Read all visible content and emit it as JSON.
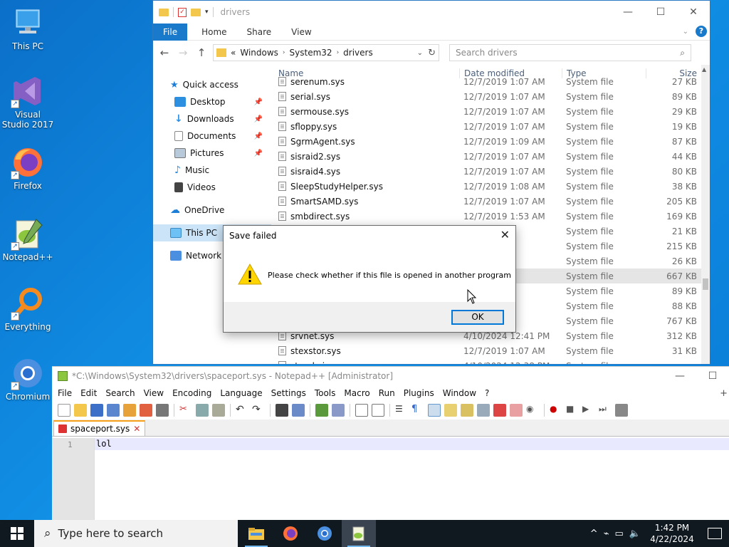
{
  "desktop": {
    "icons": [
      {
        "label": "This PC"
      },
      {
        "label": "Visual Studio 2017"
      },
      {
        "label": "Firefox"
      },
      {
        "label": "Notepad++"
      },
      {
        "label": "Everything"
      },
      {
        "label": "Chromium"
      }
    ]
  },
  "explorer": {
    "title": "drivers",
    "ribbon_tabs": [
      "File",
      "Home",
      "Share",
      "View"
    ],
    "address": {
      "parts": [
        "Windows",
        "System32",
        "drivers"
      ],
      "prefix": "«"
    },
    "search_placeholder": "Search drivers",
    "nav": {
      "quick_access": "Quick access",
      "items": [
        "Desktop",
        "Downloads",
        "Documents",
        "Pictures",
        "Music",
        "Videos"
      ],
      "onedrive": "OneDrive",
      "this_pc": "This PC",
      "network": "Network"
    },
    "columns": {
      "name": "Name",
      "date": "Date modified",
      "type": "Type",
      "size": "Size"
    },
    "files": [
      {
        "name": "serenum.sys",
        "date": "12/7/2019 1:07 AM",
        "type": "System file",
        "size": "27 KB"
      },
      {
        "name": "serial.sys",
        "date": "12/7/2019 1:07 AM",
        "type": "System file",
        "size": "89 KB"
      },
      {
        "name": "sermouse.sys",
        "date": "12/7/2019 1:07 AM",
        "type": "System file",
        "size": "29 KB"
      },
      {
        "name": "sfloppy.sys",
        "date": "12/7/2019 1:07 AM",
        "type": "System file",
        "size": "19 KB"
      },
      {
        "name": "SgrmAgent.sys",
        "date": "12/7/2019 1:09 AM",
        "type": "System file",
        "size": "87 KB"
      },
      {
        "name": "sisraid2.sys",
        "date": "12/7/2019 1:07 AM",
        "type": "System file",
        "size": "44 KB"
      },
      {
        "name": "sisraid4.sys",
        "date": "12/7/2019 1:07 AM",
        "type": "System file",
        "size": "80 KB"
      },
      {
        "name": "SleepStudyHelper.sys",
        "date": "12/7/2019 1:08 AM",
        "type": "System file",
        "size": "38 KB"
      },
      {
        "name": "SmartSAMD.sys",
        "date": "12/7/2019 1:07 AM",
        "type": "System file",
        "size": "205 KB"
      },
      {
        "name": "smbdirect.sys",
        "date": "12/7/2019 1:53 AM",
        "type": "System file",
        "size": "169 KB"
      },
      {
        "name": "",
        "date": "AM",
        "type": "System file",
        "size": "21 KB"
      },
      {
        "name": "",
        "date": "38 PM",
        "type": "System file",
        "size": "215 KB"
      },
      {
        "name": "",
        "date": "PM",
        "type": "System file",
        "size": "26 KB"
      },
      {
        "name": "",
        "date": "38 PM",
        "type": "System file",
        "size": "667 KB"
      },
      {
        "name": "",
        "date": "AM",
        "type": "System file",
        "size": "89 KB"
      },
      {
        "name": "",
        "date": "40 PM",
        "type": "System file",
        "size": "88 KB"
      },
      {
        "name": "",
        "date": "41 PM",
        "type": "System file",
        "size": "767 KB"
      },
      {
        "name": "srvnet.sys",
        "date": "4/10/2024 12:41 PM",
        "type": "System file",
        "size": "312 KB"
      },
      {
        "name": "stexstor.sys",
        "date": "12/7/2019 1:07 AM",
        "type": "System file",
        "size": "31 KB"
      },
      {
        "name": "storahci.sys",
        "date": "4/10/2024 12:38 PM",
        "type": "System file",
        "size": ""
      }
    ]
  },
  "dialog": {
    "title": "Save failed",
    "message": "Please check whether if this file is opened in another program",
    "ok_label": "OK"
  },
  "notepad": {
    "title": "*C:\\Windows\\System32\\drivers\\spaceport.sys - Notepad++ [Administrator]",
    "menu": [
      "File",
      "Edit",
      "Search",
      "View",
      "Encoding",
      "Language",
      "Settings",
      "Tools",
      "Macro",
      "Run",
      "Plugins",
      "Window",
      "?"
    ],
    "menu_plus": "+",
    "tab": "spaceport.sys",
    "line_number": "1",
    "line_text": "lol"
  },
  "taskbar": {
    "search_placeholder": "Type here to search",
    "time": "1:42 PM",
    "date": "4/22/2024"
  }
}
